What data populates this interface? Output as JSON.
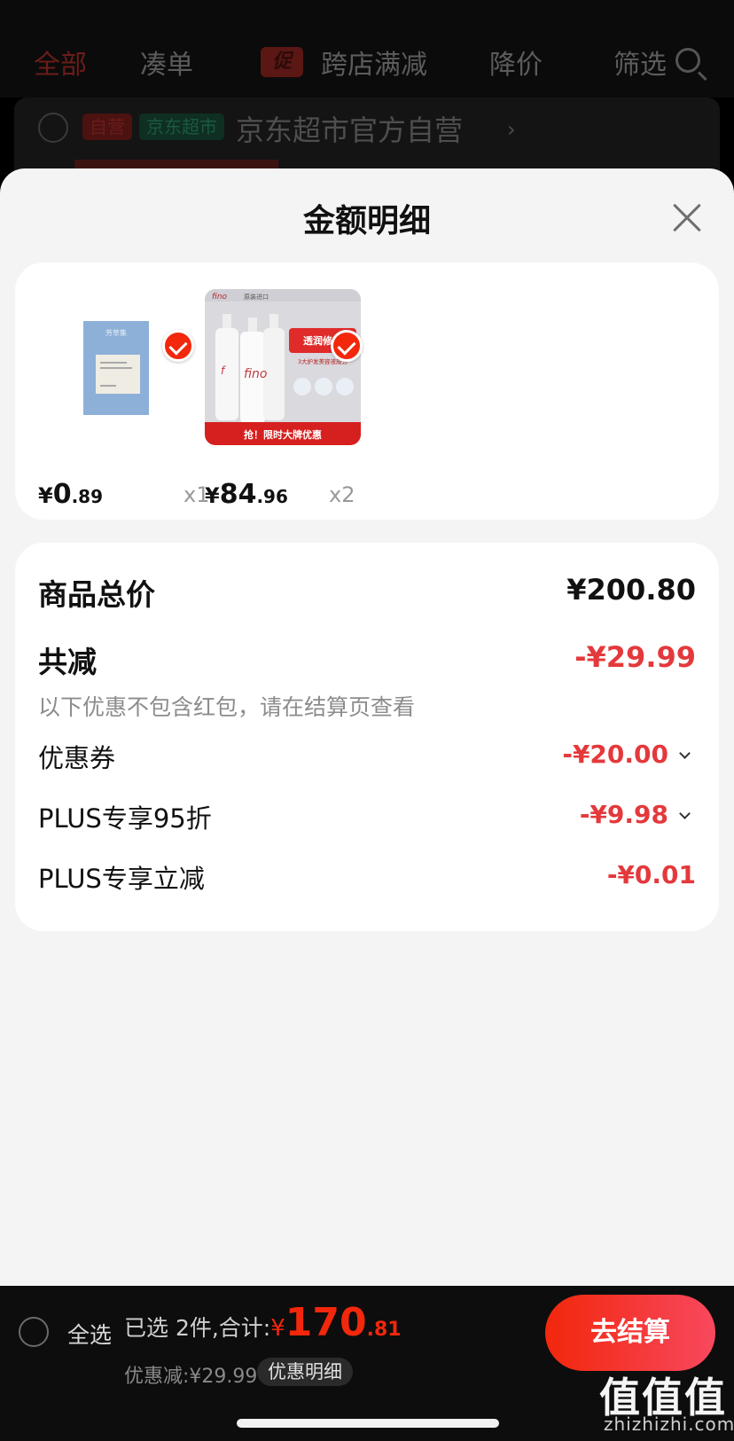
{
  "background": {
    "tabs": [
      {
        "label": "全部",
        "active": true
      },
      {
        "label": "凑单"
      },
      {
        "label": "跨店满减",
        "tag": "促"
      },
      {
        "label": "降价"
      },
      {
        "label": "筛选"
      }
    ],
    "store": {
      "badge_self": "自营",
      "badge_market": "京东超市",
      "name": "京东超市官方自营",
      "chevron": "›"
    }
  },
  "sheet": {
    "title": "金额明细",
    "close_icon": "close-icon",
    "products": [
      {
        "name": "sample-pack",
        "price_yen": "¥",
        "price_int": "0",
        "price_dec": ".89",
        "qty": "x1",
        "checked": true
      },
      {
        "name": "fino-shampoo",
        "price_yen": "¥",
        "price_int": "84",
        "price_dec": ".96",
        "qty": "x2",
        "checked": true
      }
    ],
    "product_images": {
      "sample_pack_text": "芳草集",
      "fino_brand": "fino",
      "fino_tag": "原装进口",
      "fino_headline": "透润修护",
      "fino_sub": "3大护发美容液成分",
      "fino_banner": "抢！限时大牌优惠"
    },
    "details": {
      "total_label": "商品总价",
      "total_value": "¥200.80",
      "discount_label": "共减",
      "discount_value": "-¥29.99",
      "hint": "以下优惠不包含红包，请在结算页查看",
      "items": [
        {
          "label": "优惠券",
          "value": "-¥20.00",
          "expandable": true
        },
        {
          "label": "PLUS专享95折",
          "value": "-¥9.98",
          "expandable": true
        },
        {
          "label": "PLUS专享立减",
          "value": "-¥0.01",
          "expandable": false
        }
      ]
    }
  },
  "bottom_bar": {
    "select_all_label": "全选",
    "summary_text": "已选 2件,合计:",
    "total_yen": "¥",
    "total_int": "170",
    "total_dec": ".81",
    "discount_text": "优惠减:¥29.99",
    "detail_pill": "优惠明细",
    "checkout_label": "去结算",
    "watermark": "值值值",
    "watermark_sub": "zhizhizhi.com"
  },
  "colors": {
    "accent": "#f2270c",
    "discount_red": "#e4393c",
    "sheet_bg": "#f4f4f4"
  }
}
